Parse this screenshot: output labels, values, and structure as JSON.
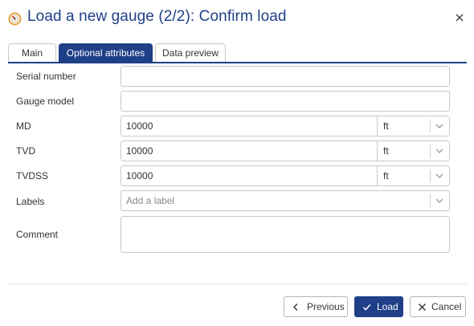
{
  "dialog": {
    "title": "Load a new gauge (2/2): Confirm load",
    "icon": "gauge-icon",
    "close_icon": "close-icon",
    "accent_color": "#1f3f88"
  },
  "tabs": [
    {
      "label": "Main",
      "active": false
    },
    {
      "label": "Optional attributes",
      "active": true
    },
    {
      "label": "Data preview",
      "active": false
    }
  ],
  "form": {
    "serial_number": {
      "label": "Serial number",
      "value": ""
    },
    "gauge_model": {
      "label": "Gauge model",
      "value": ""
    },
    "md": {
      "label": "MD",
      "value": "10000",
      "unit": "ft"
    },
    "tvd": {
      "label": "TVD",
      "value": "10000",
      "unit": "ft"
    },
    "tvdss": {
      "label": "TVDSS",
      "value": "10000",
      "unit": "ft"
    },
    "labels": {
      "label": "Labels",
      "placeholder": "Add a label"
    },
    "comment": {
      "label": "Comment",
      "value": ""
    }
  },
  "footer": {
    "previous_label": "Previous",
    "load_label": "Load",
    "cancel_label": "Cancel"
  }
}
